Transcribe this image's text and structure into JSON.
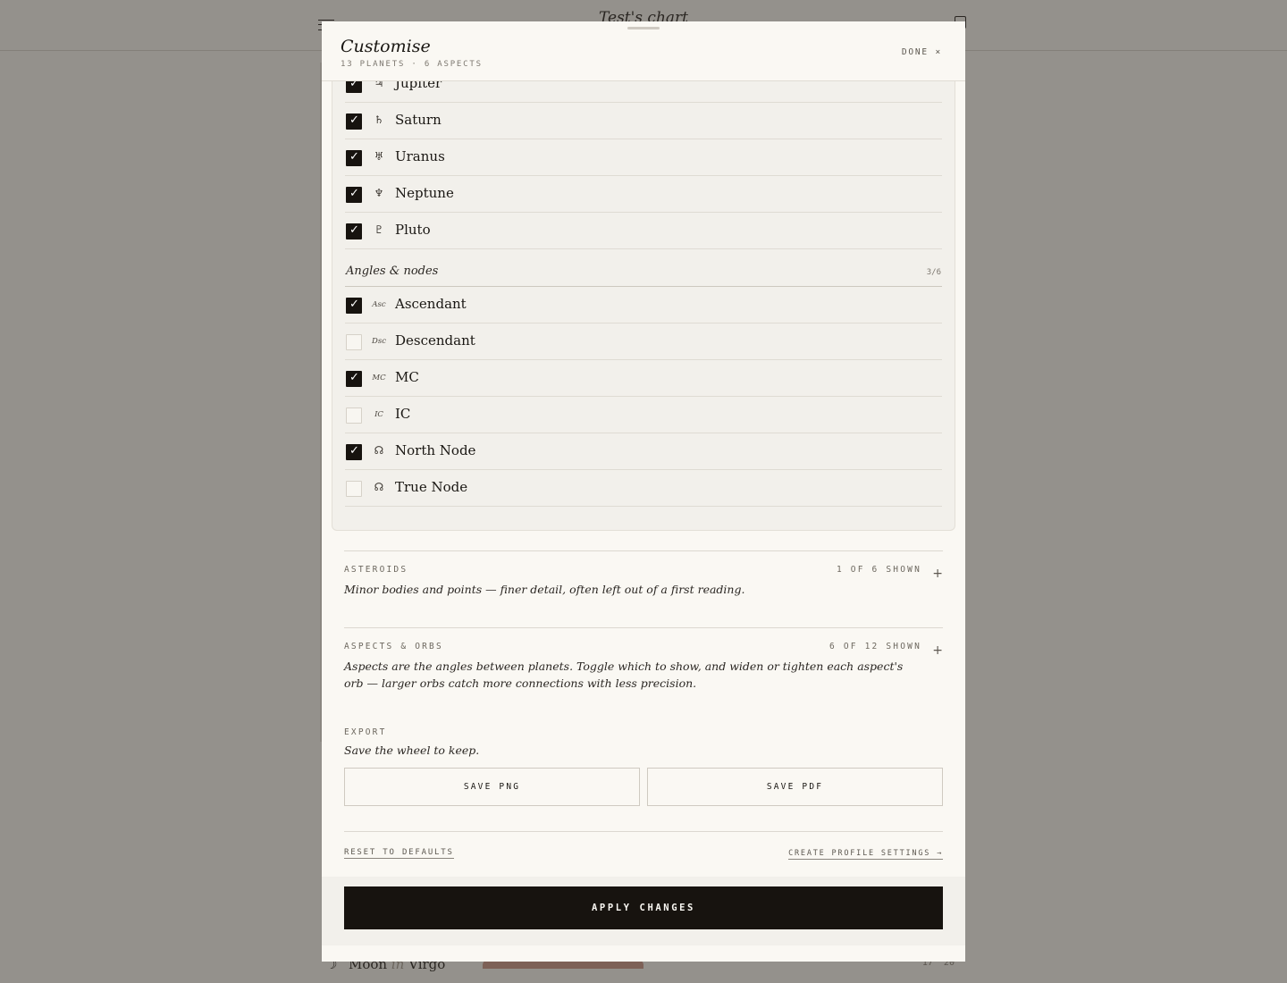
{
  "background": {
    "title": "Test's chart",
    "row_symbol": "☽",
    "row_text_a": "Moon",
    "row_in": "in",
    "row_text_b": "Virgo",
    "row_numbers": "17° 20'"
  },
  "panel": {
    "title": "Customise",
    "subtitle": "13 PLANETS · 6 ASPECTS",
    "done_label": "DONE ×"
  },
  "planets": [
    {
      "glyph": "♃",
      "label": "Jupiter",
      "checked": true
    },
    {
      "glyph": "♄",
      "label": "Saturn",
      "checked": true
    },
    {
      "glyph": "♅",
      "label": "Uranus",
      "checked": true
    },
    {
      "glyph": "♆",
      "label": "Neptune",
      "checked": true
    },
    {
      "glyph": "♇",
      "label": "Pluto",
      "checked": true
    }
  ],
  "angles_group": {
    "title": "Angles & nodes",
    "count": "3/6"
  },
  "angles": [
    {
      "glyph": "Asc",
      "label": "Ascendant",
      "checked": true
    },
    {
      "glyph": "Dsc",
      "label": "Descendant",
      "checked": false
    },
    {
      "glyph": "MC",
      "label": "MC",
      "checked": true
    },
    {
      "glyph": "IC",
      "label": "IC",
      "checked": false
    },
    {
      "glyph": "☊",
      "label": "North Node",
      "checked": true
    },
    {
      "glyph": "☊",
      "label": "True Node",
      "checked": false
    }
  ],
  "asteroids": {
    "label": "ASTEROIDS",
    "count": "1 OF 6 SHOWN",
    "plus": "+",
    "desc": "Minor bodies and points — finer detail, often left out of a first reading."
  },
  "aspects": {
    "label": "ASPECTS & ORBS",
    "count": "6 OF 12 SHOWN",
    "plus": "+",
    "desc": "Aspects are the angles between planets. Toggle which to show, and widen or tighten each aspect's orb — larger orbs catch more connections with less precision."
  },
  "export": {
    "label": "EXPORT",
    "desc": "Save the wheel to keep.",
    "save_png": "SAVE PNG",
    "save_pdf": "SAVE PDF"
  },
  "links": {
    "reset": "RESET TO DEFAULTS",
    "profile": "CREATE PROFILE SETTINGS →"
  },
  "apply_label": "APPLY CHANGES"
}
